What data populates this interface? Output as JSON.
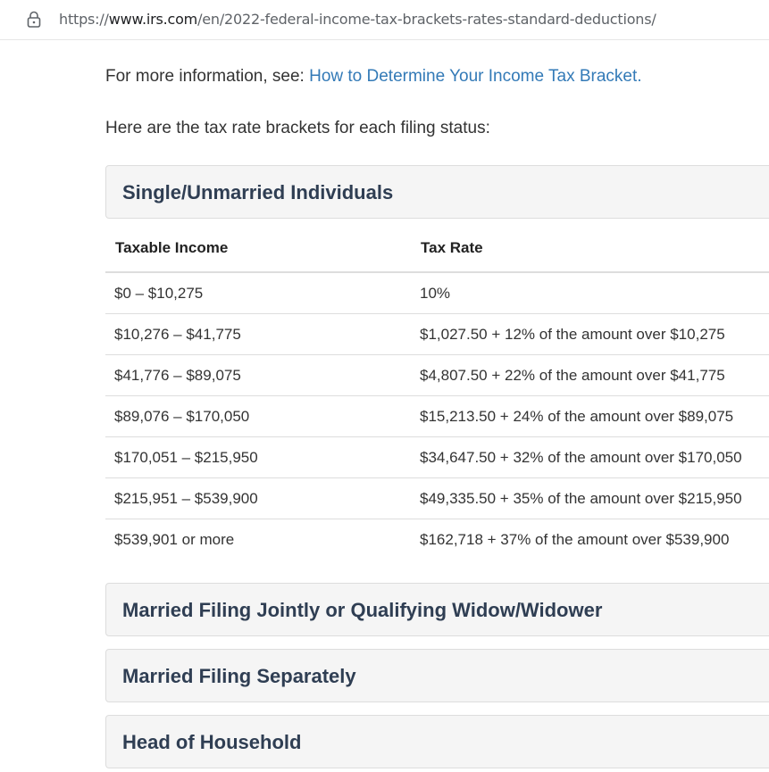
{
  "browser": {
    "url_scheme": "https://",
    "url_host": "www.irs.com",
    "url_path": "/en/2022-federal-income-tax-brackets-rates-standard-deductions/"
  },
  "intro": {
    "more_info_prefix": "For more information, see: ",
    "more_info_link": "How to Determine Your Income Tax Bracket.",
    "brackets_intro": "Here are the tax rate brackets for each filing status:"
  },
  "sections": {
    "single": "Single/Unmarried Individuals",
    "married_jointly": "Married Filing Jointly or Qualifying Widow/Widower",
    "married_separately": "Married Filing Separately",
    "head_of_household": "Head of Household"
  },
  "table": {
    "headers": [
      "Taxable Income",
      "Tax Rate"
    ],
    "rows": [
      [
        "$0 – $10,275",
        "10%"
      ],
      [
        "$10,276 – $41,775",
        "$1,027.50 + 12% of the amount over $10,275"
      ],
      [
        "$41,776 – $89,075",
        "$4,807.50 + 22% of the amount over $41,775"
      ],
      [
        "$89,076 – $170,050",
        "$15,213.50 + 24% of the amount over $89,075"
      ],
      [
        "$170,051 – $215,950",
        "$34,647.50 + 32% of the amount over $170,050"
      ],
      [
        "$215,951 – $539,900",
        "$49,335.50 + 35% of the amount over $215,950"
      ],
      [
        "$539,901 or more",
        "$162,718 + 37% of the amount over $539,900"
      ]
    ]
  },
  "colors": {
    "link": "#337ab7",
    "panel_bg": "#f5f5f5",
    "panel_title": "#2f3e53",
    "border": "#dddddd"
  }
}
